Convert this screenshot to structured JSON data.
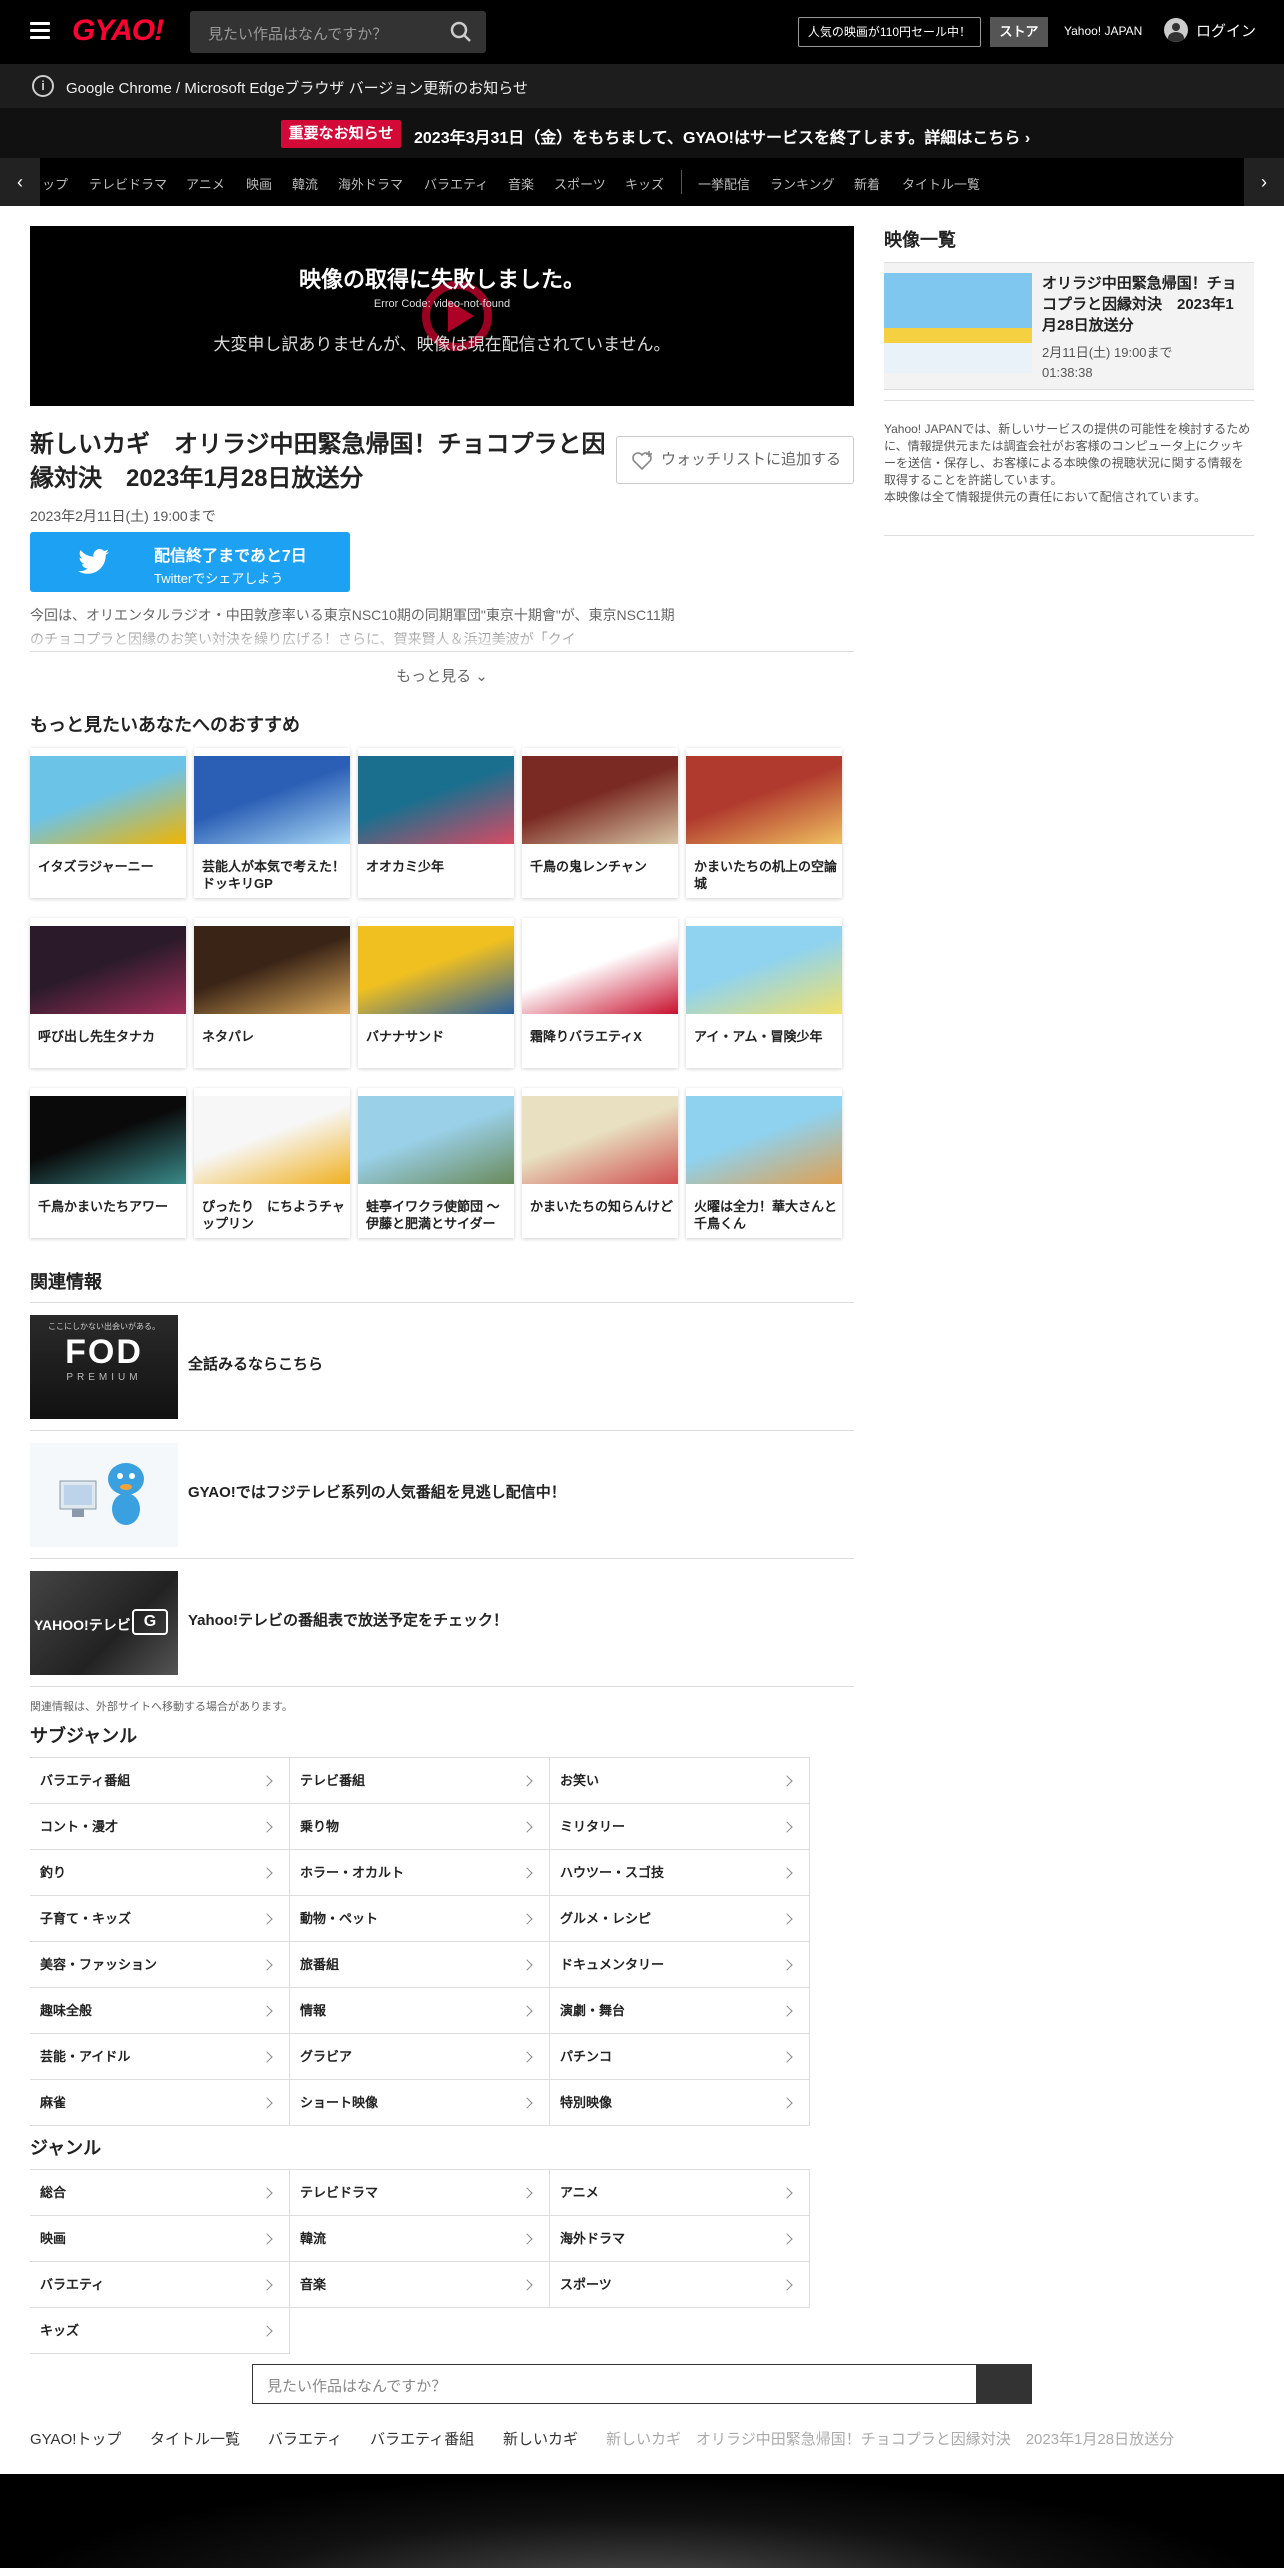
{
  "header": {
    "logo": "GYAO!",
    "search_placeholder": "見たい作品はなんですか？",
    "sale": "人気の映画が110円セール中！",
    "store": "ストア",
    "yahoo": "Yahoo! JAPAN",
    "login": "ログイン"
  },
  "browser_notice": {
    "icon": "i",
    "text": "Google Chrome / Microsoft Edgeブラウザ バージョン更新のお知らせ"
  },
  "important": {
    "badge": "重要なお知らせ",
    "text": "2023年3月31日（金）をもちまして、GYAO!はサービスを終了します。詳細はこちら"
  },
  "nav": {
    "items": [
      "ップ",
      "テレビドラマ",
      "アニメ",
      "映画",
      "韓流",
      "海外ドラマ",
      "バラエティ",
      "音楽",
      "スポーツ",
      "キッズ",
      "一挙配信",
      "ランキング",
      "新着",
      "タイトル一覧"
    ]
  },
  "player": {
    "error_title": "映像の取得に失敗しました。",
    "error_code": "Error Code: video-not-found",
    "message": "大変申し訳ありませんが、映像は現在配信されていません。"
  },
  "program": {
    "title": "新しいカギ　オリラジ中田緊急帰国！チョコプラと因縁対決　2023年1月28日放送分",
    "watchlist": "ウォッチリストに追加する",
    "end_date": "2023年2月11日(土) 19:00まで",
    "twitter_main": "配信終了まであと7日",
    "twitter_sub": "Twitterでシェアしよう",
    "description": "今回は、オリエンタルラジオ・中田敦彦率いる東京NSC10期の同期軍団\"東京十期會\"が、東京NSC11期のチョコプラと因縁のお笑い対決を繰り広げる！さらに、賀来賢人＆浜辺美波が「クイ",
    "more": "もっと見る"
  },
  "recommend": {
    "heading": "もっと見たいあなたへのおすすめ",
    "items": [
      {
        "name": "イタズラジャーニー",
        "color1": "#6cc3e8",
        "color2": "#f2b400"
      },
      {
        "name": "芸能人が本気で考えた！ドッキリGP",
        "color1": "#2b5fb5",
        "color2": "#a9d8f5"
      },
      {
        "name": "オオカミ少年",
        "color1": "#1b6f8e",
        "color2": "#d94a63"
      },
      {
        "name": "千鳥の鬼レンチャン",
        "color1": "#7a2a22",
        "color2": "#d8c6a6"
      },
      {
        "name": "かまいたちの机上の空論城",
        "color1": "#b03a2e",
        "color2": "#f0c060"
      },
      {
        "name": "呼び出し先生タナカ",
        "color1": "#2a1a2a",
        "color2": "#a0305a"
      },
      {
        "name": "ネタパレ",
        "color1": "#3a2416",
        "color2": "#d9a85a"
      },
      {
        "name": "バナナサンド",
        "color1": "#f0c020",
        "color2": "#2a5fa0"
      },
      {
        "name": "霜降りバラエティX",
        "color1": "#ffffff",
        "color2": "#c8102e"
      },
      {
        "name": "アイ・アム・冒険少年",
        "color1": "#8fd3f0",
        "color2": "#f2e06a"
      },
      {
        "name": "千鳥かまいたちアワー",
        "color1": "#0a0a0a",
        "color2": "#3a8a8a"
      },
      {
        "name": "ぴったり　にちようチャップリン",
        "color1": "#f7f7f7",
        "color2": "#f0b020"
      },
      {
        "name": "蛙亭イワクラ使節団 ～伊藤と肥満とサイダー",
        "color1": "#9ad0e8",
        "color2": "#6a8a5a"
      },
      {
        "name": "かまいたちの知らんけど",
        "color1": "#e8e0c0",
        "color2": "#d05050"
      },
      {
        "name": "火曜は全力！華大さんと千鳥くん",
        "color1": "#8ed2f0",
        "color2": "#e0a050"
      }
    ]
  },
  "related": {
    "heading": "関連情報",
    "items": [
      {
        "text": "全話みるならこちら",
        "img_text": "FOD",
        "img_sub": "PREMIUM"
      },
      {
        "text": "GYAO!ではフジテレビ系列の人気番組を見逃し配信中！",
        "img_text": "",
        "img_sub": ""
      },
      {
        "text": "Yahoo!テレビの番組表で放送予定をチェック！",
        "img_text": "YAHOO!テレビ",
        "img_sub": "G"
      }
    ],
    "note": "関連情報は、外部サイトへ移動する場合があります。"
  },
  "subgenre": {
    "heading": "サブジャンル",
    "items": [
      "バラエティ番組",
      "テレビ番組",
      "お笑い",
      "コント・漫才",
      "乗り物",
      "ミリタリー",
      "釣り",
      "ホラー・オカルト",
      "ハウツー・スゴ技",
      "子育て・キッズ",
      "動物・ペット",
      "グルメ・レシピ",
      "美容・ファッション",
      "旅番組",
      "ドキュメンタリー",
      "趣味全般",
      "情報",
      "演劇・舞台",
      "芸能・アイドル",
      "グラビア",
      "パチンコ",
      "麻雀",
      "ショート映像",
      "特別映像"
    ]
  },
  "genre": {
    "heading": "ジャンル",
    "items": [
      "総合",
      "テレビドラマ",
      "アニメ",
      "映画",
      "韓流",
      "海外ドラマ",
      "バラエティ",
      "音楽",
      "スポーツ",
      "キッズ"
    ]
  },
  "bottom_search": {
    "placeholder": "見たい作品はなんですか？"
  },
  "breadcrumb": {
    "items": [
      "GYAO!トップ",
      "タイトル一覧",
      "バラエティ",
      "バラエティ番組",
      "新しいカギ"
    ],
    "current": "新しいカギ　オリラジ中田緊急帰国！チョコプラと因縁対決　2023年1月28日放送分"
  },
  "sidebar": {
    "heading": "映像一覧",
    "video_title": "オリラジ中田緊急帰国！チョコプラと因縁対決　2023年1月28日放送分",
    "video_date": "2月11日(土) 19:00まで",
    "video_duration": "01:38:38",
    "info": "Yahoo! JAPANでは、新しいサービスの提供の可能性を検討するために、情報提供元または調査会社がお客様のコンピュータ上にクッキーを送信・保存し、お客様による本映像の視聴状況に関する情報を取得することを許諾しています。",
    "info2": "本映像は全て情報提供元の責任において配信されています。"
  },
  "colors": {
    "brand": "#ff0033",
    "badge": "#d30a38",
    "twitter": "#1da1f2"
  }
}
